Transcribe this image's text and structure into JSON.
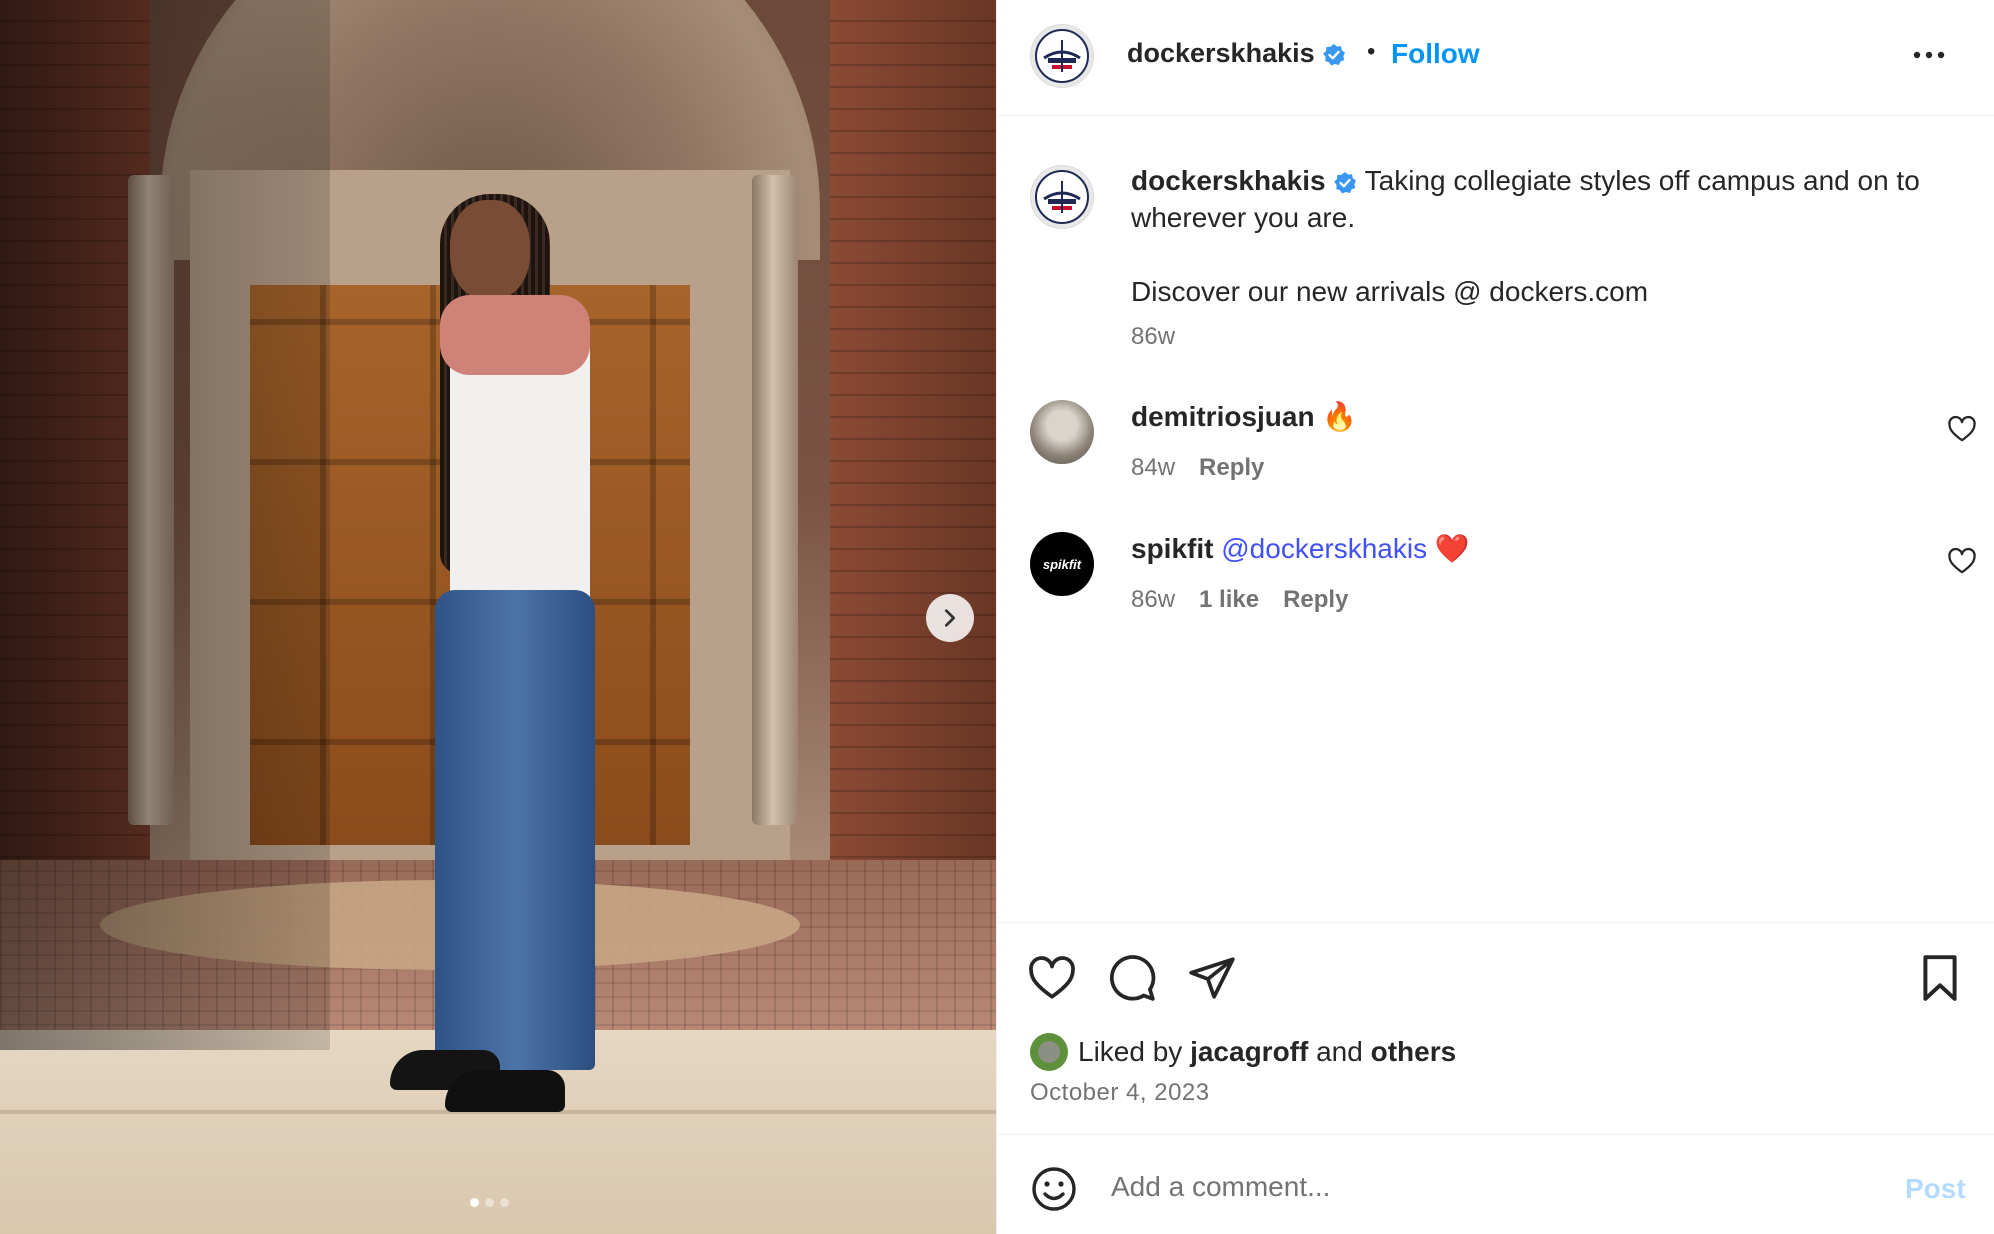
{
  "post": {
    "author": "dockerskhakis",
    "follow_label": "Follow",
    "separator": "•",
    "carousel": {
      "slides": 3,
      "active_index": 0
    },
    "caption_line1": "Taking collegiate styles off campus and on to wherever you are.",
    "caption_line2": "Discover our new arrivals @ dockers.com",
    "caption_time": "86w"
  },
  "comments": [
    {
      "user": "demitriosjuan",
      "text": "🔥",
      "time": "84w",
      "likes": "",
      "reply": "Reply"
    },
    {
      "user": "spikfit",
      "mention": "@dockerskhakis",
      "text": "❤️",
      "time": "86w",
      "likes": "1 like",
      "reply": "Reply"
    }
  ],
  "avatars": {
    "spikfit_text": "spikfit"
  },
  "footer": {
    "liked_prefix": "Liked by",
    "liked_user": "jacagroff",
    "liked_and": "and",
    "liked_others": "others",
    "date": "October 4, 2023"
  },
  "composer": {
    "placeholder": "Add a comment...",
    "post_label": "Post"
  },
  "colors": {
    "link": "#0095f6",
    "mention": "#4150f7",
    "post_disabled": "#b3dbff"
  },
  "icons": [
    "verified-badge-icon",
    "more-options-icon",
    "carousel-next-icon",
    "heart-icon",
    "comment-icon",
    "share-icon",
    "bookmark-icon",
    "emoji-icon"
  ]
}
